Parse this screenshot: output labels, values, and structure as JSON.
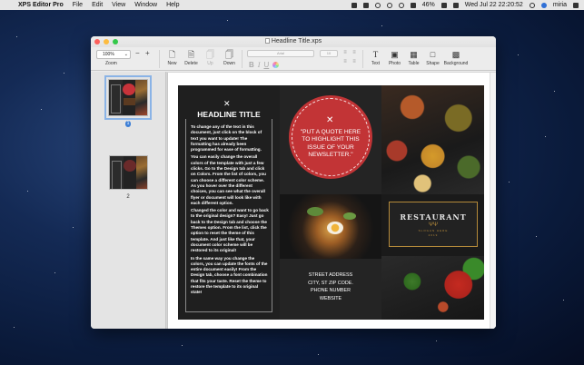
{
  "menubar": {
    "app_name": "XPS Editor Pro",
    "menus": [
      "File",
      "Edit",
      "View",
      "Window",
      "Help"
    ],
    "battery": "46%",
    "datetime": "Wed Jul 22  22:20:52",
    "user": "miria"
  },
  "window": {
    "title": "Headline Title.xps"
  },
  "toolbar": {
    "zoom_value": "100%",
    "zoom_label": "Zoom",
    "zoom_minus": "−",
    "zoom_plus": "+",
    "new_label": "New",
    "delete_label": "Delete",
    "up_label": "Up",
    "down_label": "Down",
    "font_name": "Arial",
    "font_size": "10",
    "bold": "B",
    "italic": "I",
    "underline": "U",
    "text_label": "Text",
    "photo_label": "Photo",
    "table_label": "Table",
    "shape_label": "Shape",
    "background_label": "Background"
  },
  "sidebar": {
    "pages": [
      {
        "number": "1",
        "selected": true
      },
      {
        "number": "2",
        "selected": false
      }
    ]
  },
  "brochure": {
    "headline": "HEADLINE TITLE",
    "paragraphs": [
      "To change any of the text in this document, just click on the block of text you want to update!  The formatting has already been programmed for ease of formatting.",
      "You can easily change the overall colors of the template with just a few clicks.  Go to the Design tab and click on Colors.  From the list of colors, you can choose a different color scheme.  As you hover over the different choices, you can see what the overall flyer or document will look like with each different option.",
      "Changed the color and want to go back to the original design?  Easy!  Just go back to the Design tab and choose the Themes option.  From the list, click the option to reset the theme of this template.  And just like that, your document color scheme will be restored to its original!",
      "In the same way you change the colors, you can update the fonts of the entire document easily!  From the Design tab, choose a font combination that fits your taste.  Reset the theme to restore the template to its original state!"
    ],
    "quote": "\"PUT A QUOTE HERE TO HIGHLIGHT THIS ISSUE OF YOUR NEWSLETTER.\"",
    "address_lines": [
      "STREET ADDRESS",
      "CITY, ST ZIP CODE.",
      "PHONE NUMBER",
      "WEBSITE"
    ],
    "logo": {
      "name": "RESTAURANT",
      "tagline": "SLOGAN HERE",
      "year": "2019"
    }
  },
  "colors": {
    "quote_circle": "#c23436",
    "selection": "#3d7fd6",
    "logo_gold": "#b58a3a"
  }
}
